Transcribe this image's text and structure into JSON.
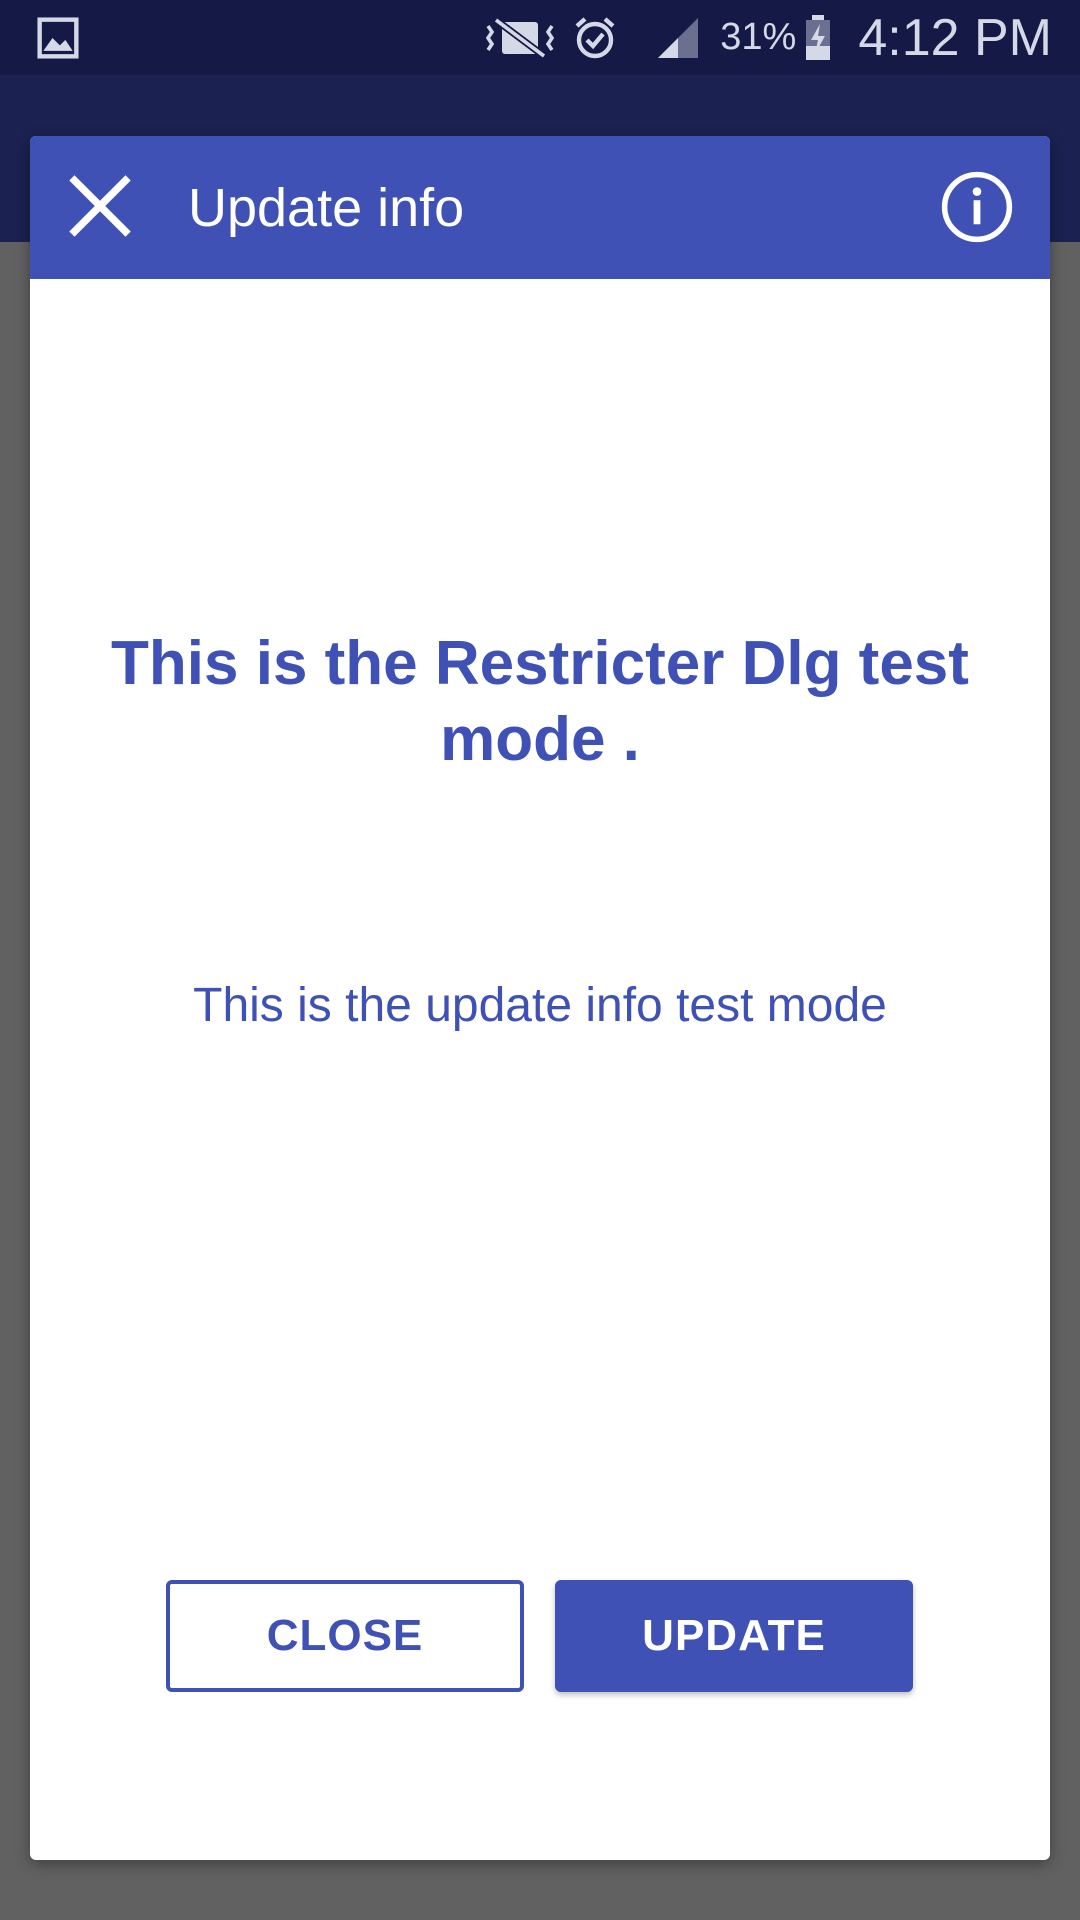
{
  "status_bar": {
    "icons": [
      "gallery-icon",
      "vibrate-icon",
      "alarm-icon",
      "signal-icon",
      "battery-charging-icon"
    ],
    "battery_percent": "31%",
    "time": "4:12 PM"
  },
  "dialog": {
    "title": "Update info",
    "header_icons": [
      "close-icon",
      "info-icon"
    ],
    "headline": "This is the Restricter Dlg test mode .",
    "message": "This is the update info test mode",
    "buttons": {
      "close_label": "CLOSE",
      "update_label": "UPDATE"
    }
  },
  "colors": {
    "accent": "#3f51b5",
    "status_bar_bg": "#141a45",
    "app_bar_bg": "#1b2251",
    "scrim": "#616161",
    "dialog_bg": "#ffffff"
  }
}
